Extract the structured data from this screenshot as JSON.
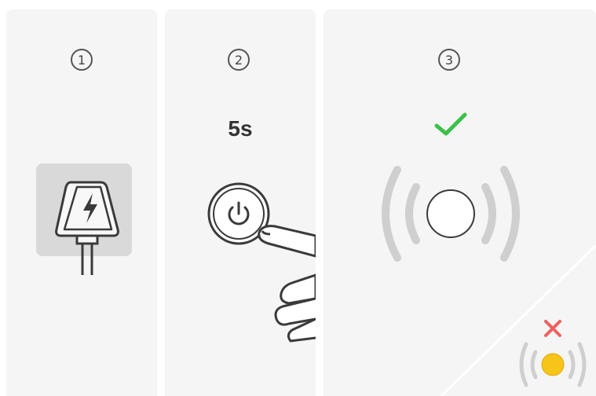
{
  "steps": [
    {
      "number": "1",
      "icon": "charger-icon"
    },
    {
      "number": "2",
      "icon": "power-button-icon",
      "duration_label": "5s"
    },
    {
      "number": "3",
      "icon": "signal-ring-icon",
      "status_icon": "checkmark-icon"
    }
  ],
  "error_state": {
    "status_icon": "x-icon",
    "indicator_icon": "yellow-signal-icon"
  },
  "colors": {
    "check": "#3cc04a",
    "error": "#f06060",
    "indicator": "#f7c419",
    "ring": "#cfcfcf",
    "panel_bg": "#f5f5f5"
  }
}
